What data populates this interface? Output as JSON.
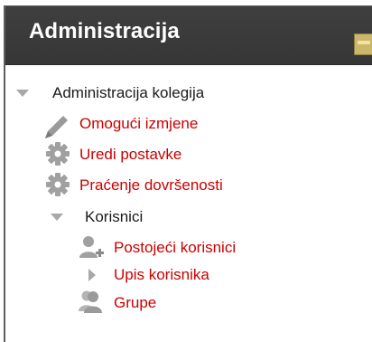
{
  "block": {
    "title": "Administracija"
  },
  "tree": {
    "root_label": "Administracija kolegija",
    "edit_label": "Omogući izmjene",
    "settings_label": "Uredi postavke",
    "completion_label": "Praćenje dovršenosti",
    "users_label": "Korisnici",
    "existing_users_label": "Postojeći korisnici",
    "enrol_label": "Upis korisnika",
    "groups_label": "Grupe"
  },
  "colors": {
    "header_bg": "#3a3a3a",
    "link": "#cc0000",
    "icon_gray": "#a8a8a8"
  }
}
